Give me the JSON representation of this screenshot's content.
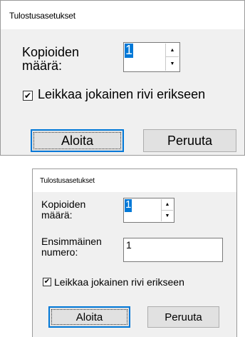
{
  "dialog1": {
    "title": "Tulostusasetukset",
    "copies": {
      "label_line1": "Kopioiden",
      "label_line2": "määrä:",
      "value": "1",
      "up_icon": "▲",
      "down_icon": "▼"
    },
    "cut_each_row": {
      "label": "Leikkaa jokainen rivi erikseen",
      "checked": true,
      "mark": "✔"
    },
    "start_label": "Aloita",
    "cancel_label": "Peruuta"
  },
  "dialog2": {
    "title": "Tulostusasetukset",
    "copies": {
      "label_line1": "Kopioiden",
      "label_line2": "määrä:",
      "value": "1",
      "up_icon": "▲",
      "down_icon": "▼"
    },
    "first_number": {
      "label_line1": "Ensimmäinen",
      "label_line2": "numero:",
      "value": "1"
    },
    "cut_each_row": {
      "label": "Leikkaa jokainen rivi erikseen",
      "checked": true,
      "mark": "✔"
    },
    "start_label": "Aloita",
    "cancel_label": "Peruuta"
  },
  "colors": {
    "dialog_bg": "#f0f0f0",
    "titlebar_bg": "#ffffff",
    "selection": "#0078d7",
    "button_bg": "#e1e1e1"
  }
}
